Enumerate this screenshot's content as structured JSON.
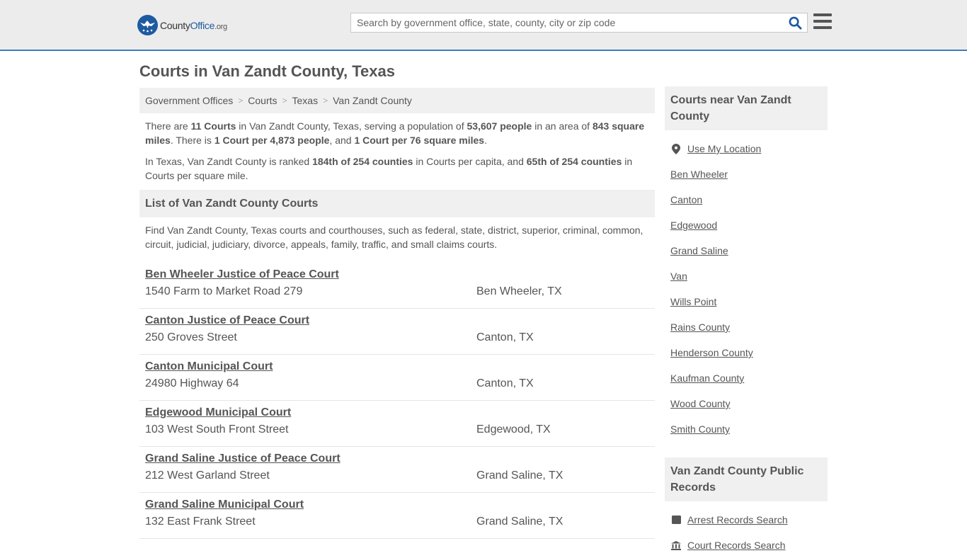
{
  "header": {
    "logo": {
      "name_part1": "County",
      "name_part2": "Office",
      "tld": ".org"
    },
    "search": {
      "placeholder": "Search by government office, state, county, city or zip code",
      "value": ""
    },
    "icons": {
      "search": "search-icon",
      "menu": "hamburger-menu-icon"
    },
    "accent_color": "#3a7cc0"
  },
  "page": {
    "title": "Courts in Van Zandt County, Texas"
  },
  "breadcrumb": [
    {
      "label": "Government Offices"
    },
    {
      "label": "Courts"
    },
    {
      "label": "Texas"
    },
    {
      "label": "Van Zandt County"
    }
  ],
  "intro": {
    "p1": {
      "t1": "There are ",
      "b1": "11 Courts",
      "t2": " in Van Zandt County, Texas, serving a population of ",
      "b2": "53,607 people",
      "t3": " in an area of ",
      "b3": "843 square miles",
      "t4": ". There is ",
      "b4": "1 Court per 4,873 people",
      "t5": ", and ",
      "b5": "1 Court per 76 square miles",
      "t6": "."
    },
    "p2": {
      "t1": "In Texas, Van Zandt County is ranked ",
      "b1": "184th of 254 counties",
      "t2": " in Courts per capita, and ",
      "b2": "65th of 254 counties",
      "t3": " in Courts per square mile."
    }
  },
  "list_section": {
    "heading": "List of Van Zandt County Courts",
    "description": "Find Van Zandt County, Texas courts and courthouses, such as federal, state, district, superior, criminal, common, circuit, judicial, judiciary, divorce, appeals, family, traffic, and small claims courts.",
    "courts": [
      {
        "name": "Ben Wheeler Justice of Peace Court",
        "address": "1540 Farm to Market Road 279",
        "city": "Ben Wheeler, TX"
      },
      {
        "name": "Canton Justice of Peace Court",
        "address": "250 Groves Street",
        "city": "Canton, TX"
      },
      {
        "name": "Canton Municipal Court",
        "address": "24980 Highway 64",
        "city": "Canton, TX"
      },
      {
        "name": "Edgewood Municipal Court",
        "address": "103 West South Front Street",
        "city": "Edgewood, TX"
      },
      {
        "name": "Grand Saline Justice of Peace Court",
        "address": "212 West Garland Street",
        "city": "Grand Saline, TX"
      },
      {
        "name": "Grand Saline Municipal Court",
        "address": "132 East Frank Street",
        "city": "Grand Saline, TX"
      }
    ]
  },
  "sidebar": {
    "nearby": {
      "heading": "Courts near Van Zandt County",
      "use_location": "Use My Location",
      "links": [
        "Ben Wheeler",
        "Canton",
        "Edgewood",
        "Grand Saline",
        "Van",
        "Wills Point",
        "Rains County",
        "Henderson County",
        "Kaufman County",
        "Wood County",
        "Smith County"
      ]
    },
    "records": {
      "heading": "Van Zandt County Public Records",
      "links": [
        {
          "label": "Arrest Records Search",
          "icon": "id-card-icon"
        },
        {
          "label": "Court Records Search",
          "icon": "courthouse-icon"
        }
      ]
    }
  }
}
